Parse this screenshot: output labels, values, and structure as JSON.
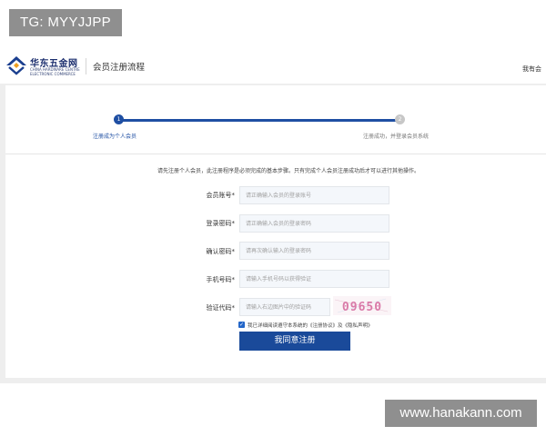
{
  "watermarks": {
    "top_left": "TG: MYYJJPP",
    "bottom_right": "www.hanakann.com"
  },
  "header": {
    "logo_cn": "华东五金网",
    "logo_en": "CHINA HARDWARE CENTRE ELECTRONIC COMMERCE",
    "title": "会员注册流程",
    "right_link": "我有会"
  },
  "progress": {
    "step1_num": "1",
    "step1_label": "注册成为个人会员",
    "step2_num": "2",
    "step2_label": "注册成功，并登录会员系统"
  },
  "notice": "请先注册个人会员，此注册程序是必须完成的基本步骤。只有完成个人会员注册成功后才可以进行其他操作。",
  "form": {
    "account": {
      "label": "会员账号*",
      "placeholder": "请正确输入会员的登录账号"
    },
    "password": {
      "label": "登录密码*",
      "placeholder": "请正确输入会员的登录密码"
    },
    "confirm": {
      "label": "确认密码*",
      "placeholder": "请再次确认输入的登录密码"
    },
    "phone": {
      "label": "手机号码*",
      "placeholder": "请输入手机号码以获得验证"
    },
    "captcha": {
      "label": "验证代码*",
      "placeholder": "请输入右边图片中的验证码",
      "image_text": "09650"
    }
  },
  "agreement": {
    "text": "我已详细阅读遵守本系统的《注册协议》及《隐私声明》"
  },
  "submit_label": "我同意注册",
  "colors": {
    "brand_blue": "#1f4fa3",
    "button_blue": "#1a4a9a",
    "background_grey": "#eeeeee"
  }
}
